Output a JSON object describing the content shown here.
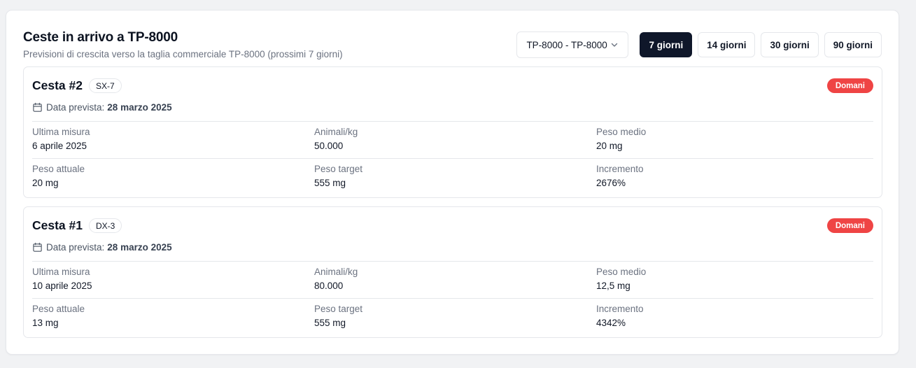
{
  "header": {
    "title": "Ceste in arrivo a TP-8000",
    "subtitle": "Previsioni di crescita verso la taglia commerciale TP-8000 (prossimi 7 giorni)"
  },
  "controls": {
    "select_value": "TP-8000 - TP-8000",
    "periods": [
      "7 giorni",
      "14 giorni",
      "30 giorni",
      "90 giorni"
    ],
    "active_period": "7 giorni"
  },
  "colors": {
    "active_button": "#0f172a",
    "badge": "#ef4444"
  },
  "cards": [
    {
      "title": "Cesta #2",
      "tag": "SX-7",
      "badge": "Domani",
      "date_label": "Data prevista:",
      "date_value": "28 marzo 2025",
      "rows": [
        [
          {
            "label": "Ultima misura",
            "value": "6 aprile 2025"
          },
          {
            "label": "Animali/kg",
            "value": "50.000"
          },
          {
            "label": "Peso medio",
            "value": "20 mg"
          }
        ],
        [
          {
            "label": "Peso attuale",
            "value": "20 mg"
          },
          {
            "label": "Peso target",
            "value": "555 mg"
          },
          {
            "label": "Incremento",
            "value": "2676%"
          }
        ]
      ]
    },
    {
      "title": "Cesta #1",
      "tag": "DX-3",
      "badge": "Domani",
      "date_label": "Data prevista:",
      "date_value": "28 marzo 2025",
      "rows": [
        [
          {
            "label": "Ultima misura",
            "value": "10 aprile 2025"
          },
          {
            "label": "Animali/kg",
            "value": "80.000"
          },
          {
            "label": "Peso medio",
            "value": "12,5 mg"
          }
        ],
        [
          {
            "label": "Peso attuale",
            "value": "13 mg"
          },
          {
            "label": "Peso target",
            "value": "555 mg"
          },
          {
            "label": "Incremento",
            "value": "4342%"
          }
        ]
      ]
    }
  ]
}
